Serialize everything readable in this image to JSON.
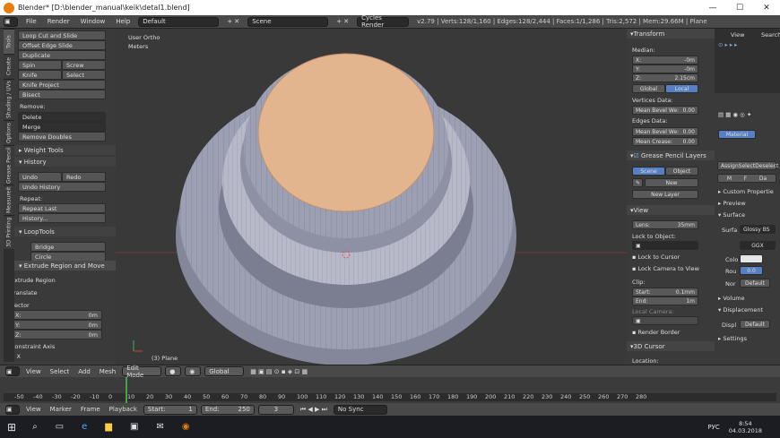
{
  "window": {
    "title": "Blender* [D:\\blender_manual\\keik\\detal1.blend]"
  },
  "menubar": {
    "items": [
      "File",
      "Render",
      "Window",
      "Help"
    ],
    "layout": "Default",
    "scene": "Scene",
    "engine": "Cycles Render",
    "stats": "v2.79 | Verts:128/1,160 | Edges:128/2,444 | Faces:1/1,286 | Tris:2,572 | Mem:29.66M | Plane"
  },
  "lefttabs": [
    "Tools",
    "Create",
    "Shading / UVs",
    "Options",
    "Grease Pencil",
    "Measureit",
    "3D Printing"
  ],
  "tools": {
    "buttons": [
      "Loop Cut and Slide",
      "Offset Edge Slide",
      "Duplicate",
      "Spin",
      "Screw",
      "Knife",
      "Select",
      "Knife Project",
      "Bisect"
    ],
    "remove_label": "Remove:",
    "delete": "Delete",
    "merge": "Merge",
    "remove_doubles": "Remove Doubles",
    "weight_tools": "Weight Tools",
    "history": "History",
    "undo": "Undo",
    "redo": "Redo",
    "undo_history": "Undo History",
    "repeat_label": "Repeat:",
    "repeat_last": "Repeat Last",
    "history_dots": "History...",
    "looptools": "LoopTools",
    "bridge": "Bridge",
    "circle": "Circle"
  },
  "operator": {
    "title": "Extrude Region and Move",
    "extrude": "Extrude Region",
    "translate": "Translate",
    "vector": "Vector",
    "x": "0m",
    "y": "0m",
    "z": "0m",
    "x_lbl": "X:",
    "y_lbl": "Y:",
    "z_lbl": "Z:",
    "constraint": "Constraint Axis",
    "cx": "X"
  },
  "viewport": {
    "view": "User Ortho",
    "units": "Meters",
    "object": "(3) Plane"
  },
  "viewheader": {
    "view": "View",
    "select": "Select",
    "add": "Add",
    "mesh": "Mesh",
    "mode": "Edit Mode",
    "pivot": "Global"
  },
  "timeline": {
    "ticks": [
      "-50",
      "-40",
      "-30",
      "-20",
      "-10",
      "0",
      "10",
      "20",
      "30",
      "40",
      "50",
      "60",
      "70",
      "80",
      "90",
      "100",
      "110",
      "120",
      "130",
      "140",
      "150",
      "160",
      "170",
      "180",
      "190",
      "200",
      "210",
      "220",
      "230",
      "240",
      "250",
      "260",
      "270",
      "280"
    ],
    "view": "View",
    "marker": "Marker",
    "frame": "Frame",
    "playback": "Playback",
    "start": "Start:",
    "start_v": "1",
    "end": "End:",
    "end_v": "250",
    "current": "3",
    "sync": "No Sync"
  },
  "npanel": {
    "transform": "Transform",
    "median": "Median:",
    "x": "-0m",
    "y": "-0m",
    "z": "2.15cm",
    "x_lbl": "X:",
    "y_lbl": "Y:",
    "z_lbl": "Z:",
    "global": "Global",
    "local": "Local",
    "vdata": "Vertices Data:",
    "mbw": "Mean Bevel We:",
    "mbw_v": "0.00",
    "edata": "Edges Data:",
    "mbw2_v": "0.00",
    "mcrease": "Mean Crease:",
    "mcrease_v": "0.00",
    "gp": "Grease Pencil Layers",
    "scene": "Scene",
    "object": "Object",
    "new": "New",
    "new_layer": "New Layer",
    "view": "View",
    "lens": "Lens:",
    "lens_v": "35mm",
    "lock_obj": "Lock to Object:",
    "lock_cursor": "Lock to Cursor",
    "lock_cam": "Lock Camera to View",
    "clip": "Clip:",
    "start": "Start:",
    "start_v": "0.1mm",
    "end": "End:",
    "end_v": "1m",
    "local_camera": "Local Camera:",
    "render_border": "Render Border",
    "cursor": "3D Cursor",
    "location": "Location:"
  },
  "props": {
    "view": "View",
    "search": "Search",
    "material": "Material",
    "assign": "Assign",
    "select": "Select",
    "deselect": "Deselect",
    "m": "M",
    "f": "F",
    "da": "Da",
    "custom": "Custom Propertie",
    "preview": "Preview",
    "surface": "Surface",
    "surf": "Surfa",
    "glossy": "Glossy BS",
    "ggx": "GGX",
    "color": "Colo",
    "rough": "Rou",
    "rough_v": "0.0",
    "normal": "Nor",
    "default": "Default",
    "volume": "Volume",
    "displacement": "Displacement",
    "displ": "Displ",
    "settings": "Settings"
  },
  "taskbar": {
    "lang": "РУС",
    "time": "8:54",
    "date": "04.03.2018"
  }
}
